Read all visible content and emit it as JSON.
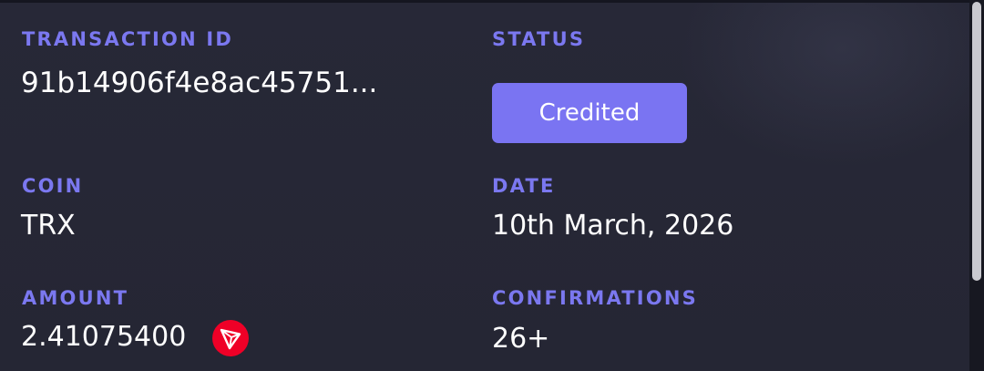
{
  "transaction": {
    "id_label": "TRANSACTION ID",
    "id_value": "91b14906f4e8ac45751...",
    "status_label": "STATUS",
    "status_value": "Credited",
    "coin_label": "COIN",
    "coin_value": "TRX",
    "date_label": "DATE",
    "date_value": "10th March, 2026",
    "amount_label": "AMOUNT",
    "amount_value": "2.41075400",
    "confirmations_label": "CONFIRMATIONS",
    "confirmations_value": "26+"
  },
  "icons": {
    "coin_icon": "tron-icon"
  },
  "colors": {
    "background": "#272837",
    "label": "#7b78f0",
    "value": "#ffffff",
    "status_badge": "#7a74f2",
    "tron_red": "#ef0027"
  }
}
